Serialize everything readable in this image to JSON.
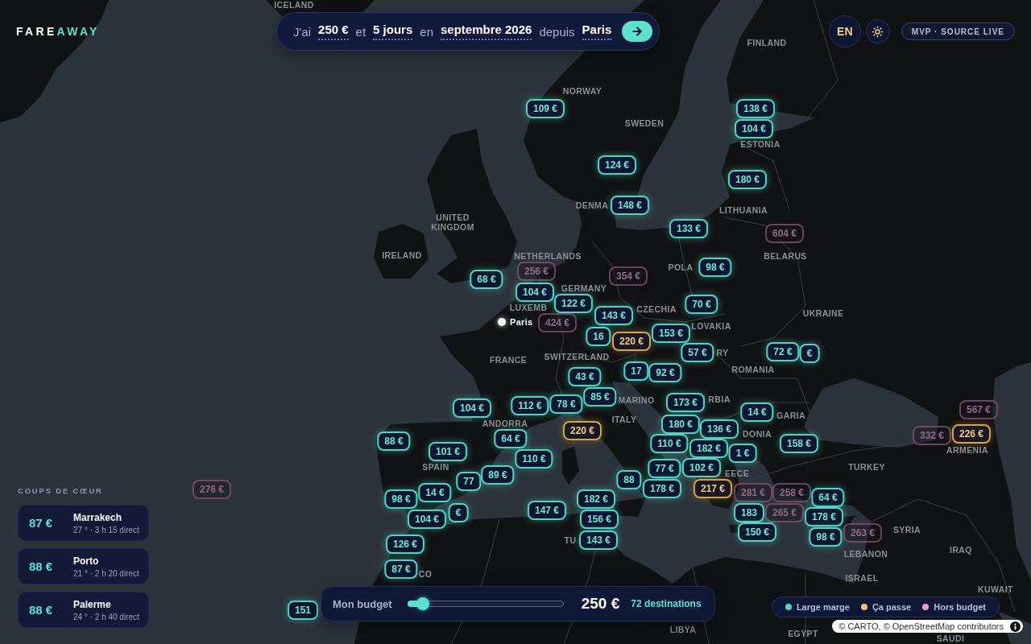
{
  "header": {
    "logo": [
      {
        "text": "FARE",
        "accent": false
      },
      {
        "text": "AWAY",
        "accent": true
      }
    ],
    "query": [
      {
        "kind": "word",
        "text": "J'ai"
      },
      {
        "kind": "value",
        "text": "250 €"
      },
      {
        "kind": "word",
        "text": "et"
      },
      {
        "kind": "value",
        "text": "5 jours"
      },
      {
        "kind": "word",
        "text": "en"
      },
      {
        "kind": "value",
        "text": "septembre 2026"
      },
      {
        "kind": "word",
        "text": "depuis"
      },
      {
        "kind": "value",
        "text": "Paris"
      }
    ],
    "language": "EN",
    "badge": "MVP · SOURCE LIVE"
  },
  "map": {
    "origin": "Paris",
    "country_labels": [
      "ICELAND",
      "FINLAND",
      "NORWAY",
      "SWEDEN",
      "ESTONIA",
      "DENMA",
      "LITHUANIA",
      "UNITED KINGDOM",
      "IRELAND",
      "NETHERLANDS",
      "BELARUS",
      "POLA",
      "GERMANY",
      "LUXEMB",
      "CZECHIA",
      "UKRAINE",
      "LOVAKIA",
      "FRANCE",
      "SWITZERLAND",
      "RY",
      "ROMANIA",
      "MARINO",
      "RBIA",
      "ANDORRA",
      "ITALY",
      "GARIA",
      "DONIA",
      "ARMENIA",
      "SPAIN",
      "EECE",
      "TURKEY",
      "SYRIA",
      "TU",
      "LEBANON",
      "IRAQ",
      "CO",
      "ISRAEL",
      "KUWAIT",
      "LIBYA",
      "EGYPT",
      "SAUDI"
    ],
    "markers": [
      {
        "price": "109 €",
        "kind": "large"
      },
      {
        "price": "138 €",
        "kind": "large"
      },
      {
        "price": "104 €",
        "kind": "large"
      },
      {
        "price": "124 €",
        "kind": "large"
      },
      {
        "price": "180 €",
        "kind": "large"
      },
      {
        "price": "148 €",
        "kind": "large"
      },
      {
        "price": "133 €",
        "kind": "large"
      },
      {
        "price": "604 €",
        "kind": "over"
      },
      {
        "price": "68 €",
        "kind": "large"
      },
      {
        "price": "256 €",
        "kind": "over"
      },
      {
        "price": "354 €",
        "kind": "over"
      },
      {
        "price": "98 €",
        "kind": "large"
      },
      {
        "price": "104 €",
        "kind": "large"
      },
      {
        "price": "122 €",
        "kind": "large"
      },
      {
        "price": "70 €",
        "kind": "large"
      },
      {
        "price": "424 €",
        "kind": "over"
      },
      {
        "price": "143 €",
        "kind": "large"
      },
      {
        "price": "16",
        "kind": "large"
      },
      {
        "price": "220 €",
        "kind": "ok"
      },
      {
        "price": "153 €",
        "kind": "large"
      },
      {
        "price": "57 €",
        "kind": "large"
      },
      {
        "price": "72 €",
        "kind": "large"
      },
      {
        "price": "€",
        "kind": "large"
      },
      {
        "price": "43 €",
        "kind": "large"
      },
      {
        "price": "17",
        "kind": "large"
      },
      {
        "price": "92 €",
        "kind": "large"
      },
      {
        "price": "104 €",
        "kind": "large"
      },
      {
        "price": "112 €",
        "kind": "large"
      },
      {
        "price": "78 €",
        "kind": "large"
      },
      {
        "price": "85 €",
        "kind": "large"
      },
      {
        "price": "173 €",
        "kind": "large"
      },
      {
        "price": "14 €",
        "kind": "large"
      },
      {
        "price": "567 €",
        "kind": "over"
      },
      {
        "price": "88 €",
        "kind": "large"
      },
      {
        "price": "64 €",
        "kind": "large"
      },
      {
        "price": "220 €",
        "kind": "ok"
      },
      {
        "price": "110 €",
        "kind": "large"
      },
      {
        "price": "180 €",
        "kind": "large"
      },
      {
        "price": "136 €",
        "kind": "large"
      },
      {
        "price": "182 €",
        "kind": "large"
      },
      {
        "price": "158 €",
        "kind": "large"
      },
      {
        "price": "332 €",
        "kind": "over"
      },
      {
        "price": "226 €",
        "kind": "ok"
      },
      {
        "price": "101 €",
        "kind": "large"
      },
      {
        "price": "110 €",
        "kind": "large"
      },
      {
        "price": "1 €",
        "kind": "large"
      },
      {
        "price": "77",
        "kind": "large"
      },
      {
        "price": "89 €",
        "kind": "large"
      },
      {
        "price": "88",
        "kind": "large"
      },
      {
        "price": "77 €",
        "kind": "large"
      },
      {
        "price": "102 €",
        "kind": "large"
      },
      {
        "price": "276 €",
        "kind": "over"
      },
      {
        "price": "98 €",
        "kind": "large"
      },
      {
        "price": "14 €",
        "kind": "large"
      },
      {
        "price": "182 €",
        "kind": "large"
      },
      {
        "price": "178 €",
        "kind": "large"
      },
      {
        "price": "217 €",
        "kind": "ok"
      },
      {
        "price": "281 €",
        "kind": "over"
      },
      {
        "price": "258 €",
        "kind": "over"
      },
      {
        "price": "64 €",
        "kind": "large"
      },
      {
        "price": "104 €",
        "kind": "large"
      },
      {
        "price": "€",
        "kind": "large"
      },
      {
        "price": "147 €",
        "kind": "large"
      },
      {
        "price": "156 €",
        "kind": "large"
      },
      {
        "price": "183",
        "kind": "large"
      },
      {
        "price": "265 €",
        "kind": "over"
      },
      {
        "price": "178 €",
        "kind": "large"
      },
      {
        "price": "126 €",
        "kind": "large"
      },
      {
        "price": "143 €",
        "kind": "large"
      },
      {
        "price": "150 €",
        "kind": "large"
      },
      {
        "price": "98 €",
        "kind": "large"
      },
      {
        "price": "263 €",
        "kind": "over"
      },
      {
        "price": "87 €",
        "kind": "large"
      },
      {
        "price": "151",
        "kind": "large"
      }
    ]
  },
  "favorites": {
    "title": "COUPS DE CŒUR",
    "items": [
      {
        "price": "87 €",
        "city": "Marrakech",
        "detail": "27 ° · 3 h 15 direct"
      },
      {
        "price": "88 €",
        "city": "Porto",
        "detail": "21 ° · 2 h 20 direct"
      },
      {
        "price": "88 €",
        "city": "Palerme",
        "detail": "24 ° · 2 h 40 direct"
      }
    ]
  },
  "budget": {
    "label": "Mon budget",
    "level": 0.1,
    "value": "250 €",
    "count": "72 destinations"
  },
  "legend": [
    {
      "label": "Large marge",
      "color": "#4fd8c4"
    },
    {
      "label": "Ça passe",
      "color": "#f2c46b"
    },
    {
      "label": "Hors budget",
      "color": "#e89bc6"
    }
  ],
  "attribution": "© CARTO, © OpenStreetMap contributors"
}
